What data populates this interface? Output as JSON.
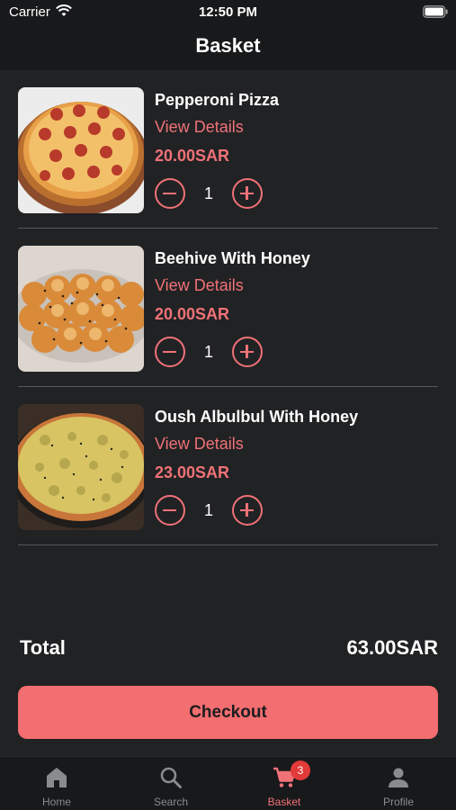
{
  "status_bar": {
    "carrier": "Carrier",
    "time": "12:50 PM"
  },
  "header": {
    "title": "Basket"
  },
  "items": [
    {
      "name": "Pepperoni Pizza",
      "details_label": "View Details",
      "price": "20.00SAR",
      "quantity": "1",
      "image": "pepperoni-pizza"
    },
    {
      "name": "Beehive With Honey",
      "details_label": "View Details",
      "price": "20.00SAR",
      "quantity": "1",
      "image": "beehive-bread"
    },
    {
      "name": "Oush Albulbul With Honey",
      "details_label": "View Details",
      "price": "23.00SAR",
      "quantity": "1",
      "image": "oush-albulbul"
    }
  ],
  "summary": {
    "total_label": "Total",
    "total_value": "63.00SAR"
  },
  "checkout": {
    "label": "Checkout"
  },
  "tab_bar": {
    "tabs": [
      {
        "label": "Home",
        "icon": "home-icon",
        "active": false
      },
      {
        "label": "Search",
        "icon": "search-icon",
        "active": false
      },
      {
        "label": "Basket",
        "icon": "cart-icon",
        "active": true,
        "badge": "3"
      },
      {
        "label": "Profile",
        "icon": "person-icon",
        "active": false
      }
    ]
  },
  "colors": {
    "accent": "#f07277",
    "background": "#212224",
    "bar": "#18191b",
    "button": "#f36e70"
  }
}
